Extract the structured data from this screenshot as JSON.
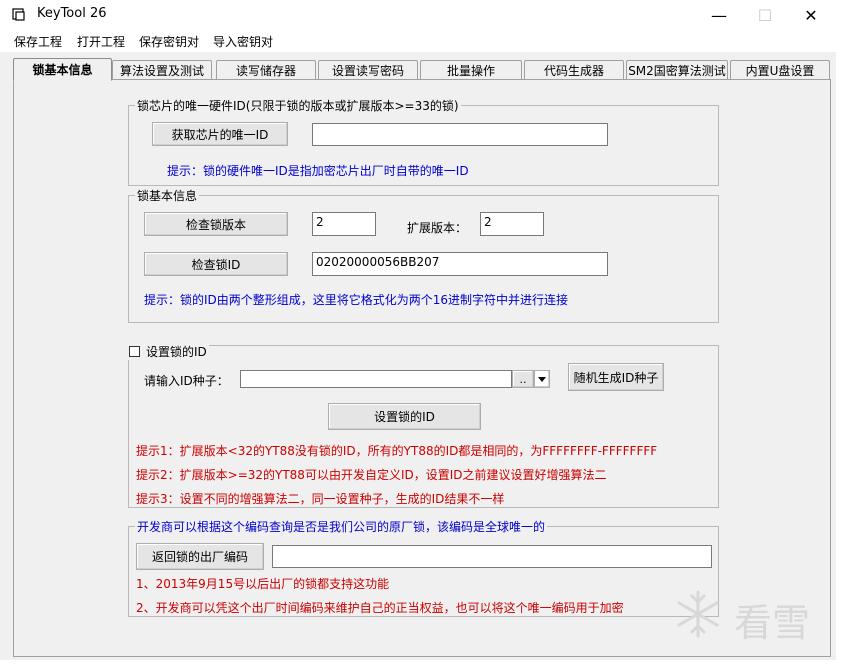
{
  "window": {
    "title": "KeyTool 26",
    "controls": {
      "minimize": "—",
      "maximize": "☐",
      "close": "✕"
    }
  },
  "menu": [
    "保存工程",
    "打开工程",
    "保存密钥对",
    "导入密钥对"
  ],
  "tabs": [
    "锁基本信息",
    "算法设置及测试",
    "读写储存器",
    "设置读写密码",
    "批量操作",
    "代码生成器",
    "SM2国密算法测试",
    "内置U盘设置"
  ],
  "group_uid": {
    "title": "锁芯片的唯一硬件ID(只限于锁的版本或扩展版本>=33的锁)",
    "get_button": "获取芯片的唯一ID",
    "uid_value": "",
    "hint": "提示：锁的硬件唯一ID是指加密芯片出厂时自带的唯一ID"
  },
  "group_basic": {
    "title": "锁基本信息",
    "check_version_button": "检查锁版本",
    "version_value": "2",
    "ext_version_label": "扩展版本：",
    "ext_version_value": "2",
    "check_id_button": "检查锁ID",
    "id_value": "02020000056BB207",
    "hint": "提示：锁的ID由两个整形组成，这里将它格式化为两个16进制字符中并进行连接"
  },
  "group_setid": {
    "checkbox_label": "设置锁的ID",
    "seed_label": "请输入ID种子：",
    "seed_value": "",
    "dots_button": "..",
    "random_button": "随机生成ID种子",
    "set_button": "设置锁的ID",
    "hint1": "提示1：扩展版本<32的YT88没有锁的ID，所有的YT88的ID都是相同的，为FFFFFFFF-FFFFFFFF",
    "hint2": "提示2：扩展版本>=32的YT88可以由开发自定义ID，设置ID之前建议设置好增强算法二",
    "hint3": "提示3：设置不同的增强算法二，同一设置种子，生成的ID结果不一样"
  },
  "group_factory": {
    "title": "开发商可以根据这个编码查询是否是我们公司的原厂锁，该编码是全球唯一的",
    "return_button": "返回锁的出厂编码",
    "code_value": "",
    "note1": "1、2013年9月15号以后出厂的锁都支持这功能",
    "note2": "2、开发商可以凭这个出厂时间编码来维护自己的正当权益，也可以将这个唯一编码用于加密"
  },
  "watermark": {
    "text": "看雪",
    "icon": "snowflake-icon"
  },
  "colors": {
    "hint_blue": "#0000cc",
    "hint_red": "#cc0000",
    "panel_bg": "#f0f0f0"
  }
}
